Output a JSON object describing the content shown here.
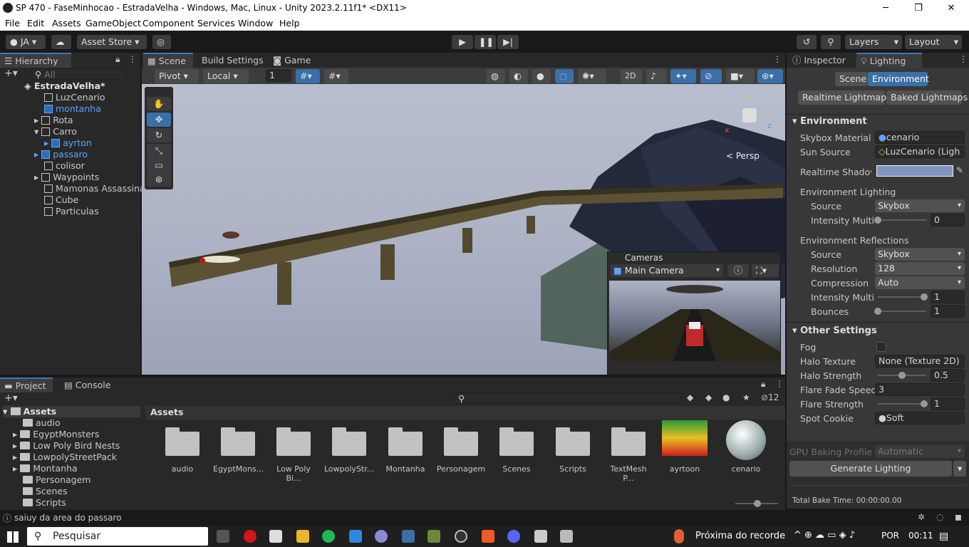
{
  "window": {
    "title": "SP 470 - FaseMinhocao - EstradaVelha - Windows, Mac, Linux - Unity 2023.2.11f1* <DX11>",
    "minimize": "─",
    "maximize": "❐",
    "close": "✕"
  },
  "menu": [
    "File",
    "Edit",
    "Assets",
    "GameObject",
    "Component",
    "Services",
    "Window",
    "Help"
  ],
  "toolbar": {
    "account": "JA",
    "asset_store": "Asset Store",
    "layers": "Layers",
    "layout": "Layout"
  },
  "hierarchy": {
    "tab": "Hierarchy",
    "search_placeholder": "All",
    "scene": "EstradaVelha*",
    "items": [
      "LuzCenario",
      "montanha",
      "Rota",
      "Carro",
      "ayrton",
      "passaro",
      "colisor",
      "Waypoints",
      "Mamonas Assassinas",
      "Cube",
      "Particulas"
    ]
  },
  "scene_tabs": {
    "scene": "Scene",
    "build": "Build Settings",
    "game": "Game"
  },
  "scene_toolbar": {
    "pivot": "Pivot",
    "local": "Local",
    "grid_value": "1",
    "mode_2d": "2D"
  },
  "gizmo": {
    "label": "< Persp",
    "x": "x",
    "y": "y",
    "z": "z"
  },
  "cameras": {
    "title": "Cameras",
    "selected": "Main Camera"
  },
  "inspector": {
    "tab_inspector": "Inspector",
    "tab_lighting": "Lighting",
    "sub_scene": "Scene",
    "sub_environment": "Environment",
    "realtime_lightmaps": "Realtime Lightmaps",
    "baked_lightmaps": "Baked Lightmaps",
    "environment_header": "Environment",
    "skybox_material_label": "Skybox Material",
    "skybox_material_value": "cenario",
    "sun_source_label": "Sun Source",
    "sun_source_value": "LuzCenario (Ligh",
    "realtime_shadow_label": "Realtime Shadow C",
    "env_lighting_label": "Environment Lighting",
    "source_label": "Source",
    "source_value": "Skybox",
    "intensity_label": "Intensity Multipl",
    "intensity_value": "0",
    "env_reflections_label": "Environment Reflections",
    "refl_source_label": "Source",
    "refl_source_value": "Skybox",
    "resolution_label": "Resolution",
    "resolution_value": "128",
    "compression_label": "Compression",
    "compression_value": "Auto",
    "refl_intensity_label": "Intensity Multipl",
    "refl_intensity_value": "1",
    "bounces_label": "Bounces",
    "bounces_value": "1",
    "other_header": "Other Settings",
    "fog_label": "Fog",
    "halo_texture_label": "Halo Texture",
    "halo_texture_value": "None (Texture 2D)",
    "halo_strength_label": "Halo Strength",
    "halo_strength_value": "0.5",
    "flare_fade_label": "Flare Fade Speed",
    "flare_fade_value": "3",
    "flare_strength_label": "Flare Strength",
    "flare_strength_value": "1",
    "spot_cookie_label": "Spot Cookie",
    "spot_cookie_value": "Soft",
    "gpu_baking_label": "GPU Baking Profile",
    "gpu_baking_value": "Automatic",
    "generate_lighting": "Generate Lighting",
    "total_bake": "Total Bake Time: 00:00:00.00",
    "shadow_color": "#8294c0"
  },
  "project": {
    "tab_project": "Project",
    "tab_console": "Console",
    "root": "Assets",
    "breadcrumb": "Assets",
    "badge_count": "12",
    "tree": [
      "audio",
      "EgyptMonsters",
      "Low Poly Bird Nests",
      "LowpolyStreetPack",
      "Montanha",
      "Personagem",
      "Scenes",
      "Scripts"
    ],
    "assets": [
      "audio",
      "EgyptMons...",
      "Low Poly Bi...",
      "LowpolyStr...",
      "Montanha",
      "Personagem",
      "Scenes",
      "Scripts",
      "TextMesh P...",
      "ayrtoon",
      "cenario"
    ]
  },
  "status": {
    "message": "saiuy da area do passaro"
  },
  "taskbar": {
    "search": "Pesquisar",
    "weather": "Próxima do recorde",
    "lang": "POR",
    "time": "00:11"
  },
  "colors": {
    "accent": "#3a79bb",
    "selected_blue": "#5ca3ff"
  }
}
